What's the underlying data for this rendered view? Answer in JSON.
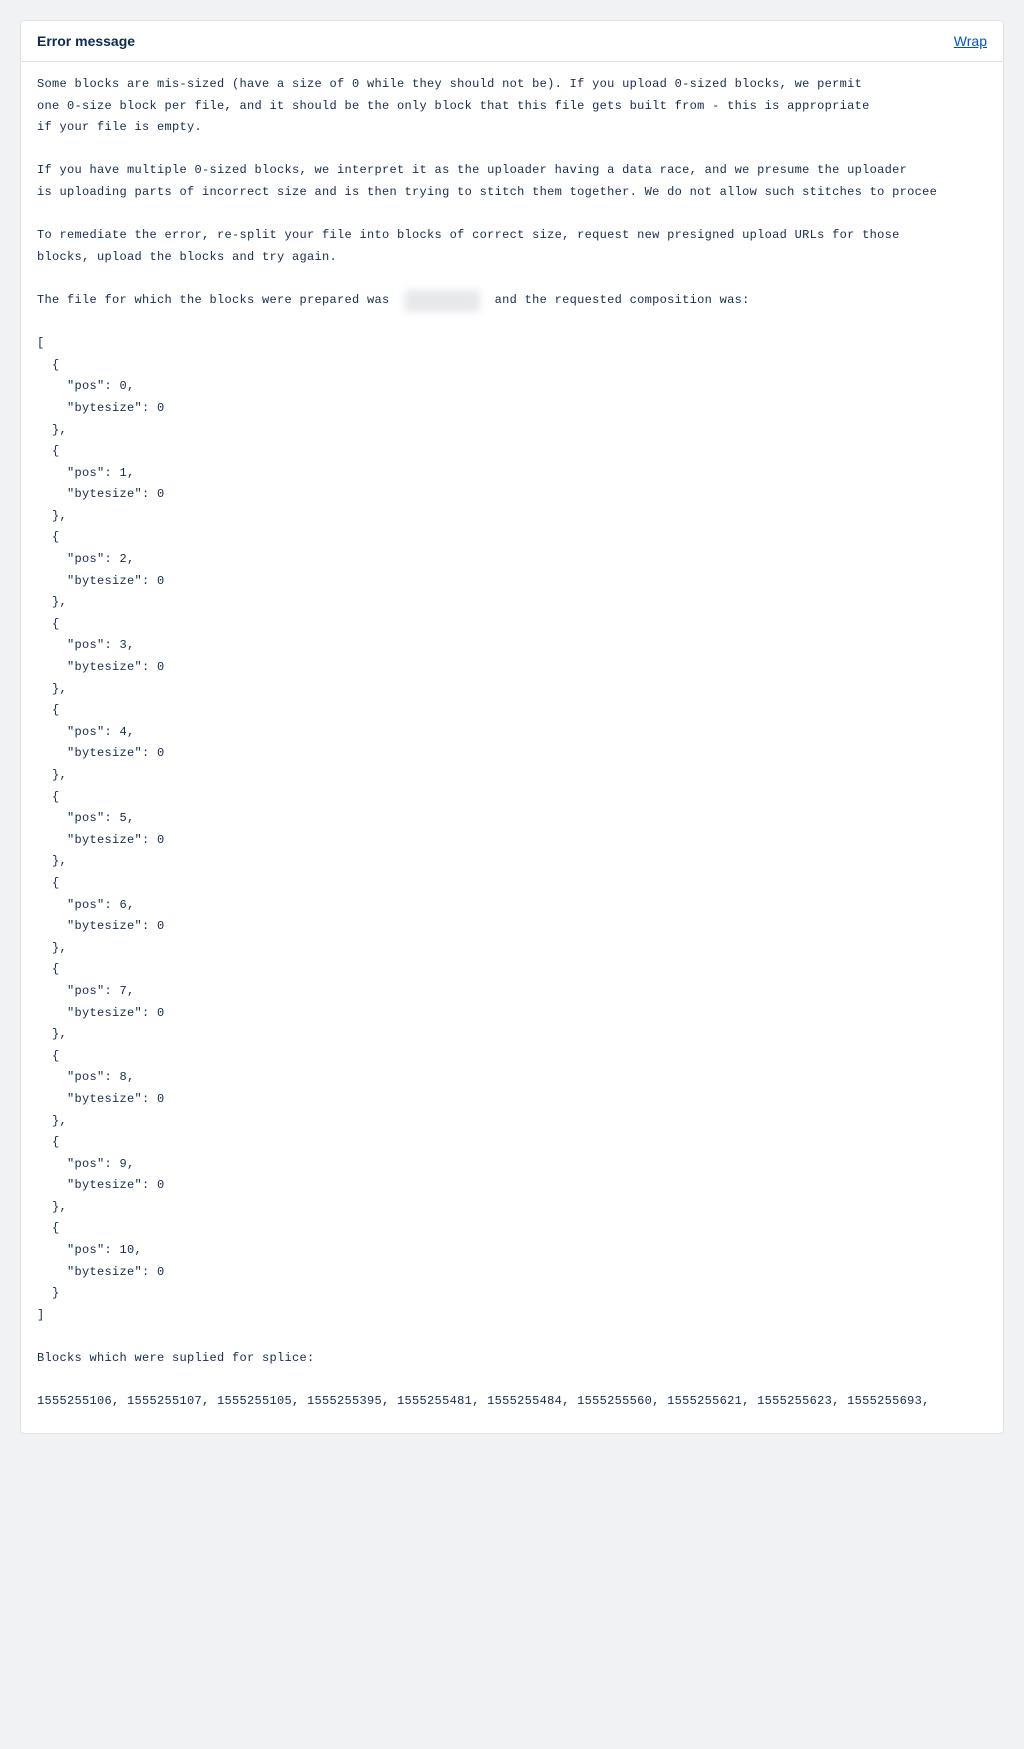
{
  "header": {
    "title": "Error message",
    "wrap_label": "Wrap"
  },
  "message": {
    "para1": "Some blocks are mis-sized (have a size of 0 while they should not be). If you upload 0-sized blocks, we permit\none 0-size block per file, and it should be the only block that this file gets built from - this is appropriate\nif your file is empty.",
    "para2": "If you have multiple 0-sized blocks, we interpret it as the uploader having a data race, and we presume the uploader\nis uploading parts of incorrect size and is then trying to stitch them together. We do not allow such stitches to procee",
    "para3": "To remediate the error, re-split your file into blocks of correct size, request new presigned upload URLs for those\nblocks, upload the blocks and try again.",
    "para4_pre": "The file for which the blocks were prepared was ",
    "para4_redacted": "██_███_██_",
    "para4_post": " and the requested composition was:",
    "composition": [
      {
        "pos": 0,
        "bytesize": 0
      },
      {
        "pos": 1,
        "bytesize": 0
      },
      {
        "pos": 2,
        "bytesize": 0
      },
      {
        "pos": 3,
        "bytesize": 0
      },
      {
        "pos": 4,
        "bytesize": 0
      },
      {
        "pos": 5,
        "bytesize": 0
      },
      {
        "pos": 6,
        "bytesize": 0
      },
      {
        "pos": 7,
        "bytesize": 0
      },
      {
        "pos": 8,
        "bytesize": 0
      },
      {
        "pos": 9,
        "bytesize": 0
      },
      {
        "pos": 10,
        "bytesize": 0
      }
    ],
    "blocks_label": "Blocks which were suplied for splice:",
    "block_ids": [
      1555255106,
      1555255107,
      1555255105,
      1555255395,
      1555255481,
      1555255484,
      1555255560,
      1555255621,
      1555255623,
      1555255693
    ]
  }
}
